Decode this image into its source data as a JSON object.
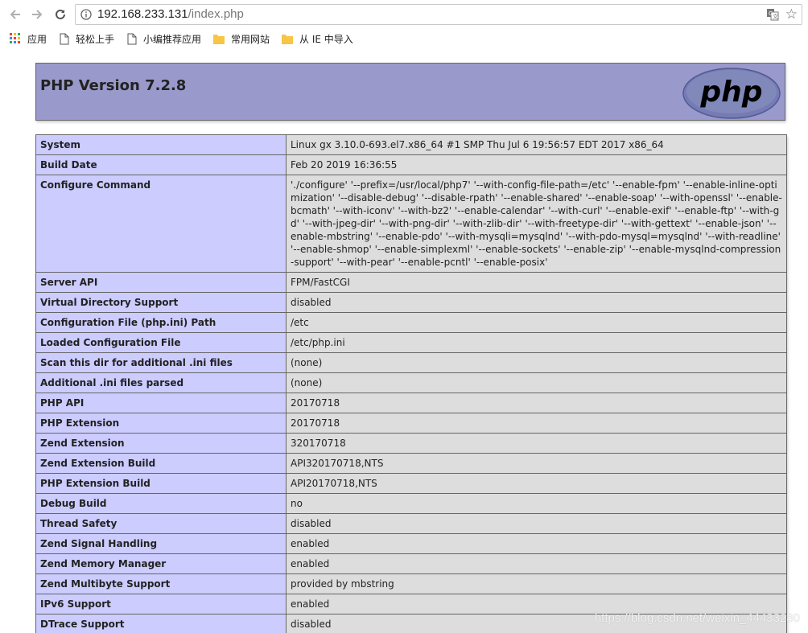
{
  "browser": {
    "url_host": "192.168.233.131",
    "url_path": "/index.php",
    "bookmarks": [
      {
        "label": "应用",
        "icon": "apps-grid-icon"
      },
      {
        "label": "轻松上手",
        "icon": "page-icon"
      },
      {
        "label": "小编推荐应用",
        "icon": "page-icon"
      },
      {
        "label": "常用网站",
        "icon": "folder-icon"
      },
      {
        "label": "从 IE 中导入",
        "icon": "folder-icon"
      }
    ]
  },
  "php": {
    "title": "PHP Version 7.2.8",
    "logo_text": "php",
    "rows": [
      {
        "key": "System",
        "value": "Linux gx 3.10.0-693.el7.x86_64 #1 SMP Thu Jul 6 19:56:57 EDT 2017 x86_64"
      },
      {
        "key": "Build Date",
        "value": "Feb 20 2019 16:36:55"
      },
      {
        "key": "Configure Command",
        "value": "'./configure' '--prefix=/usr/local/php7' '--with-config-file-path=/etc' '--enable-fpm' '--enable-inline-optimization' '--disable-debug' '--disable-rpath' '--enable-shared' '--enable-soap' '--with-openssl' '--enable-bcmath' '--with-iconv' '--with-bz2' '--enable-calendar' '--with-curl' '--enable-exif' '--enable-ftp' '--with-gd' '--with-jpeg-dir' '--with-png-dir' '--with-zlib-dir' '--with-freetype-dir' '--with-gettext' '--enable-json' '--enable-mbstring' '--enable-pdo' '--with-mysqli=mysqlnd' '--with-pdo-mysql=mysqlnd' '--with-readline' '--enable-shmop' '--enable-simplexml' '--enable-sockets' '--enable-zip' '--enable-mysqlnd-compression-support' '--with-pear' '--enable-pcntl' '--enable-posix'"
      },
      {
        "key": "Server API",
        "value": "FPM/FastCGI"
      },
      {
        "key": "Virtual Directory Support",
        "value": "disabled"
      },
      {
        "key": "Configuration File (php.ini) Path",
        "value": "/etc"
      },
      {
        "key": "Loaded Configuration File",
        "value": "/etc/php.ini"
      },
      {
        "key": "Scan this dir for additional .ini files",
        "value": "(none)"
      },
      {
        "key": "Additional .ini files parsed",
        "value": "(none)"
      },
      {
        "key": "PHP API",
        "value": "20170718"
      },
      {
        "key": "PHP Extension",
        "value": "20170718"
      },
      {
        "key": "Zend Extension",
        "value": "320170718"
      },
      {
        "key": "Zend Extension Build",
        "value": "API320170718,NTS"
      },
      {
        "key": "PHP Extension Build",
        "value": "API20170718,NTS"
      },
      {
        "key": "Debug Build",
        "value": "no"
      },
      {
        "key": "Thread Safety",
        "value": "disabled"
      },
      {
        "key": "Zend Signal Handling",
        "value": "enabled"
      },
      {
        "key": "Zend Memory Manager",
        "value": "enabled"
      },
      {
        "key": "Zend Multibyte Support",
        "value": "provided by mbstring"
      },
      {
        "key": "IPv6 Support",
        "value": "enabled"
      },
      {
        "key": "DTrace Support",
        "value": "disabled"
      }
    ]
  },
  "watermark": "https://blog.csdn.net/weixin_44433280",
  "colors": {
    "header_bg": "#9999cc",
    "key_bg": "#ccccff",
    "value_bg": "#dddddd",
    "logo_bg": "#777bb4"
  }
}
